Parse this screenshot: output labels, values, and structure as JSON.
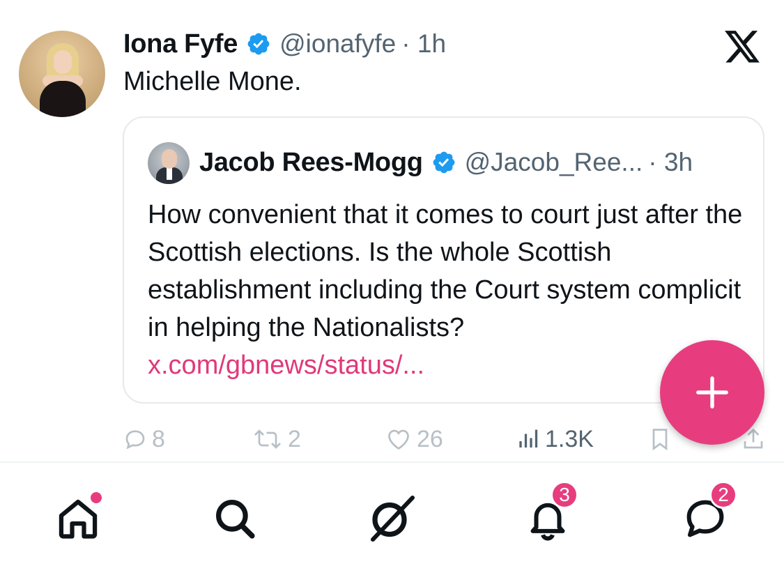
{
  "tweet": {
    "author_name": "Iona Fyfe",
    "handle": "@ionafyfe",
    "time": "· 1h",
    "text": "Michelle Mone."
  },
  "quote": {
    "author_name": "Jacob Rees-Mogg",
    "handle": "@Jacob_Ree...",
    "time": "· 3h",
    "text": "How convenient that it comes to court just after the Scottish elections. Is the whole Scottish establishment including the Court system complicit in helping the Nationalists?",
    "link": "x.com/gbnews/status/..."
  },
  "actions": {
    "replies": "8",
    "reposts": "2",
    "likes": "26",
    "views": "1.3K"
  },
  "nav": {
    "notifications_badge": "3",
    "messages_badge": "2"
  },
  "icons": {
    "brand": "x-logo-icon",
    "verified": "verified-badge-icon",
    "compose": "plus-icon",
    "reply": "reply-icon",
    "repost": "repost-icon",
    "like": "heart-icon",
    "views": "views-icon",
    "bookmark": "bookmark-icon",
    "share": "share-icon",
    "home": "home-icon",
    "search": "search-icon",
    "grok": "grok-icon",
    "notifications": "bell-icon",
    "messages": "message-icon"
  },
  "colors": {
    "accent": "#e73d7f",
    "link": "#e0397a",
    "verified": "#1d9bf0",
    "secondary_text": "#536471"
  }
}
